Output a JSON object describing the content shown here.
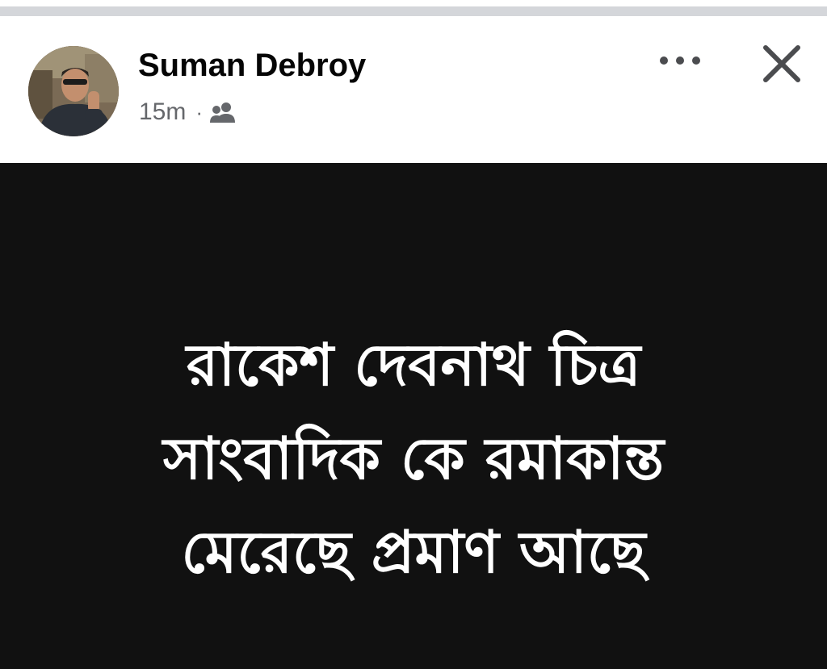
{
  "post": {
    "author": "Suman Debroy",
    "timestamp": "15m",
    "separator": "·",
    "audience_icon": "friends-icon",
    "text_lines": [
      "রাকেশ দেবনাথ চিত্র",
      "সাংবাদিক কে রমাকান্ত",
      "মেরেছে প্রমাণ আছে"
    ]
  },
  "actions": {
    "more_icon": "more-horizontal-icon",
    "close_icon": "close-icon"
  },
  "colors": {
    "name_text": "#050505",
    "meta_text": "#65676b",
    "image_background": "#111111",
    "image_text": "#ffffff",
    "divider": "#d4d6da"
  }
}
